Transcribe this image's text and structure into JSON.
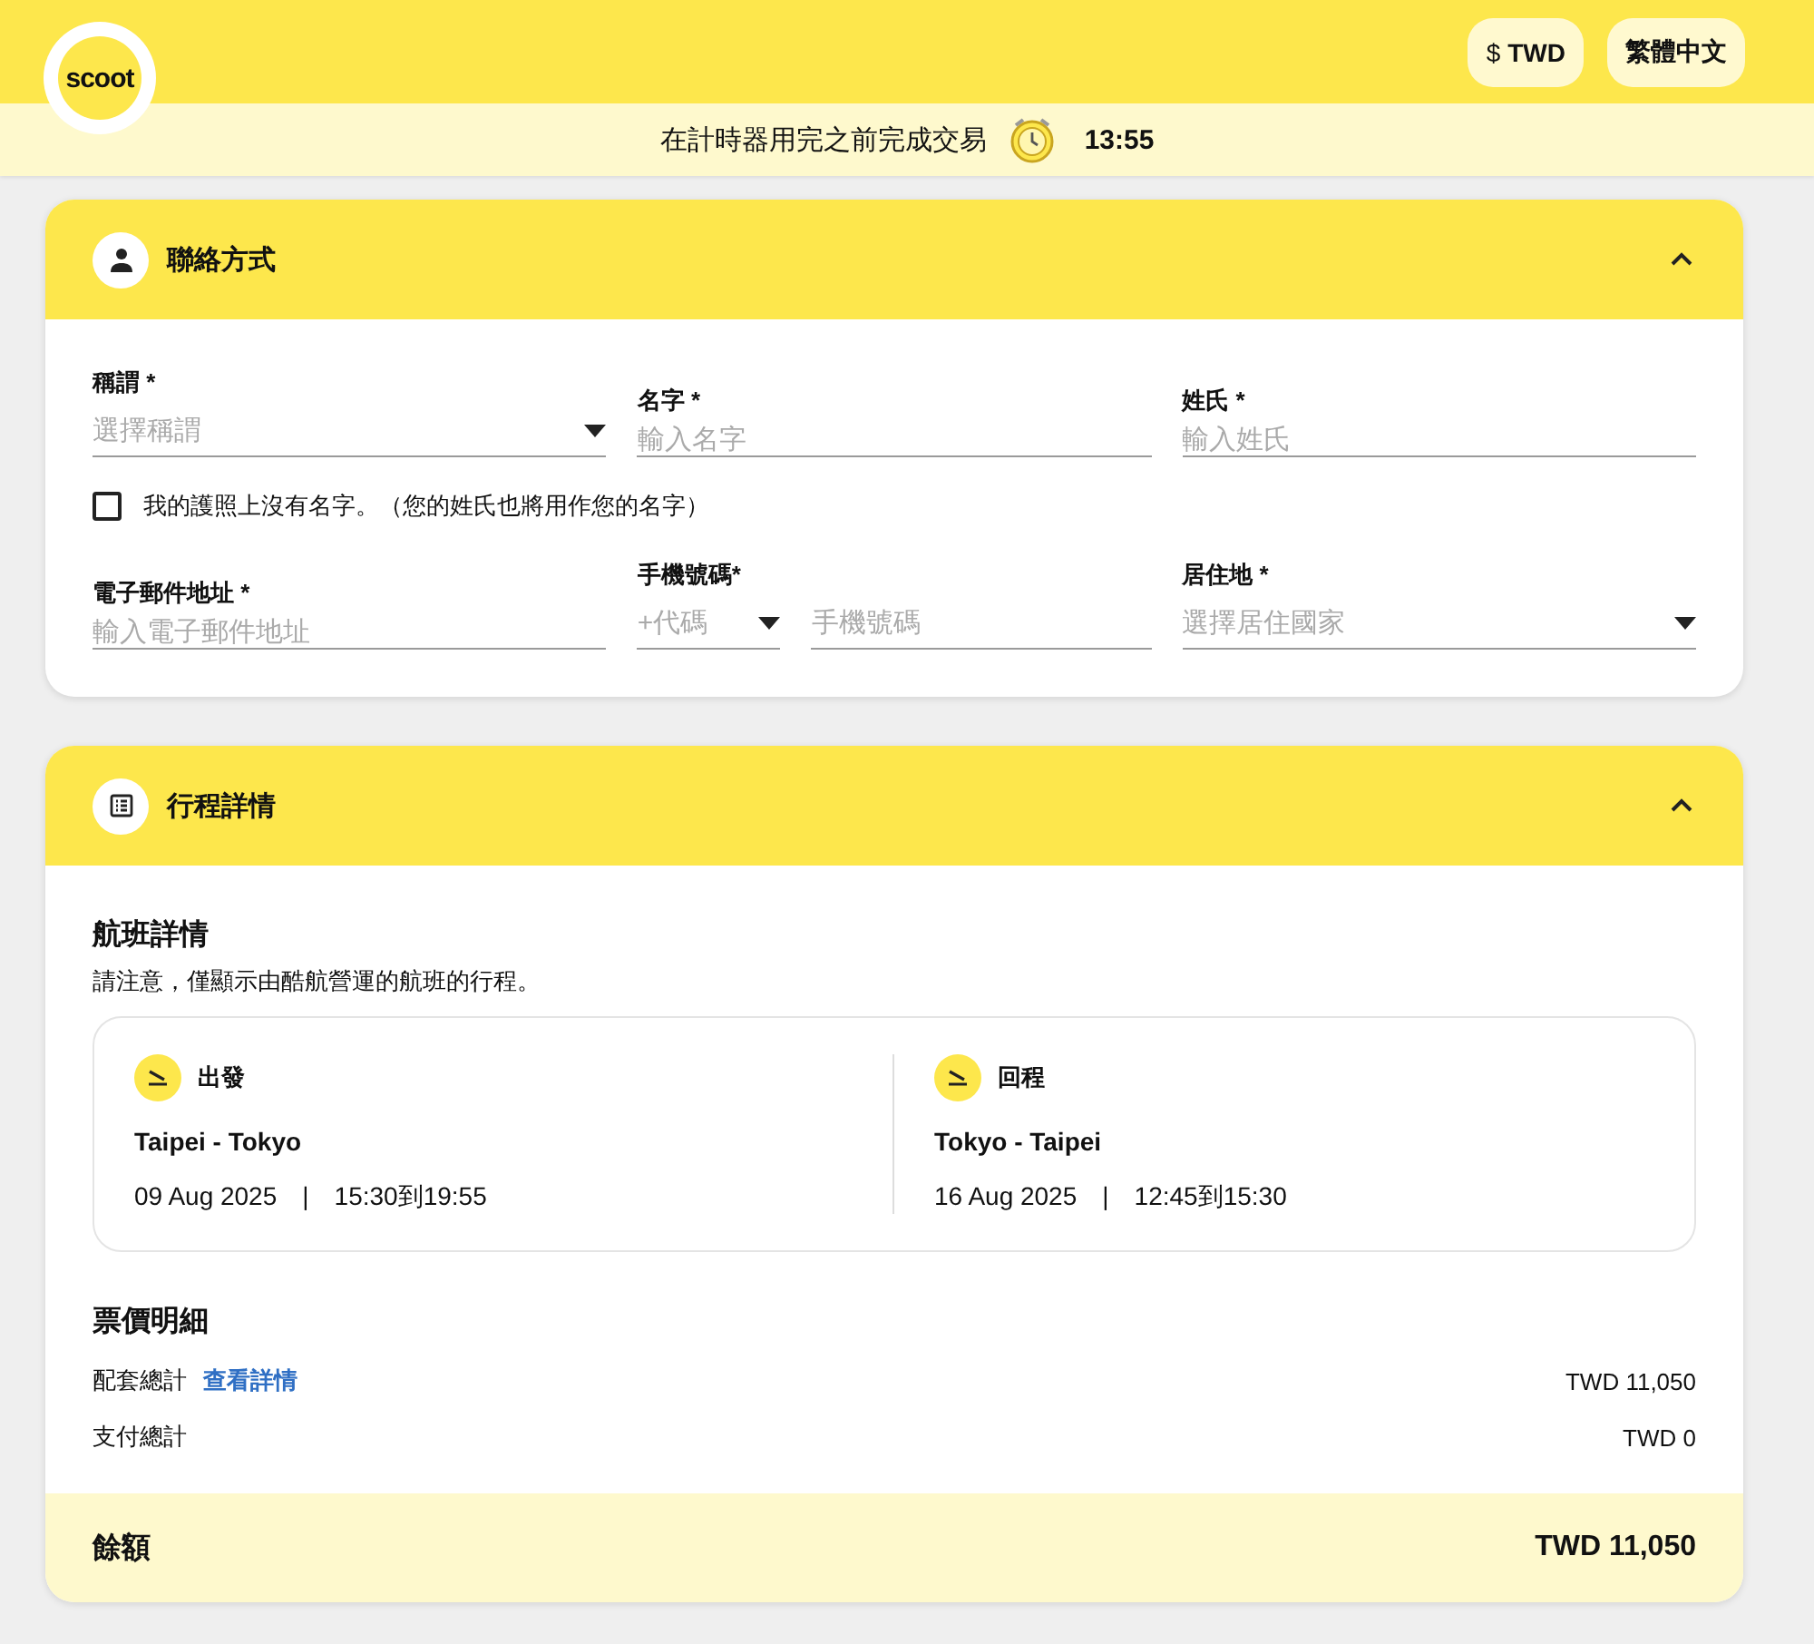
{
  "header": {
    "logo": "scoot",
    "currency": {
      "symbol": "$",
      "code": "TWD"
    },
    "language": "繁體中文"
  },
  "timer": {
    "message": "在計時器用完之前完成交易",
    "time": "13:55"
  },
  "contact": {
    "title": "聯絡方式",
    "expanded": true,
    "rows": [
      [
        {
          "kind": "select",
          "label": "稱謂 *",
          "placeholder": "選擇稱謂"
        },
        {
          "kind": "input",
          "label": "名字 *",
          "placeholder": "輸入名字"
        },
        {
          "kind": "input",
          "label": "姓氏 *",
          "placeholder": "輸入姓氏"
        }
      ],
      [
        {
          "kind": "input",
          "label": "電子郵件地址 *",
          "placeholder": "輸入電子郵件地址"
        },
        {
          "kind": "phone",
          "label": "手機號碼*",
          "code_placeholder": "+代碼",
          "placeholder": "手機號碼"
        },
        {
          "kind": "select",
          "label": "居住地 *",
          "placeholder": "選擇居住國家"
        }
      ]
    ],
    "checkbox": {
      "label": "我的護照上沒有名字。（您的姓氏也將用作您的名字）",
      "checked": false
    }
  },
  "itinerary": {
    "title": "行程詳情",
    "expanded": true,
    "flight_title": "航班詳情",
    "note": "請注意，僅顯示由酷航營運的航班的行程。",
    "trips": [
      {
        "direction": "出發",
        "route": "Taipei - Tokyo",
        "date": "09 Aug 2025",
        "separator": "|",
        "time": "15:30到19:55"
      },
      {
        "direction": "回程",
        "route": "Tokyo - Taipei",
        "date": "16 Aug 2025",
        "separator": "|",
        "time": "12:45到15:30"
      }
    ],
    "fare_title": "票價明細",
    "fare_rows": [
      {
        "label": "配套總計",
        "link": "查看詳情",
        "amount": "TWD 11,050"
      },
      {
        "label": "支付總計",
        "amount": "TWD 0"
      }
    ],
    "balance": {
      "label": "餘額",
      "amount": "TWD 11,050"
    }
  }
}
